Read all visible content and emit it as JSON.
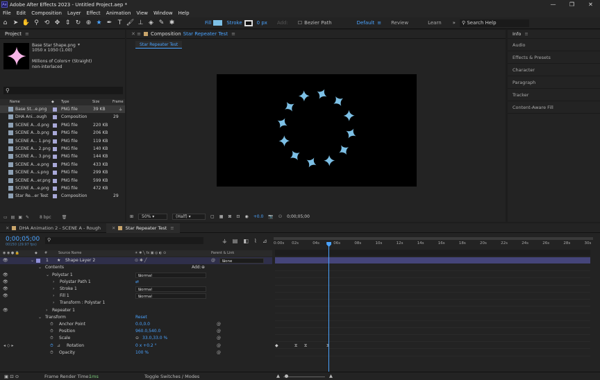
{
  "app": {
    "logo": "Ae",
    "title": "Adobe After Effects 2023 - Untitled Project.aep *"
  },
  "window_controls": [
    "—",
    "❐",
    "✕"
  ],
  "menu": [
    "File",
    "Edit",
    "Composition",
    "Layer",
    "Effect",
    "Animation",
    "View",
    "Window",
    "Help"
  ],
  "toolbar": {
    "fill_label": "Fill",
    "stroke_label": "Stroke",
    "stroke_px": "0 px",
    "add_label": "Add:",
    "bezier_label": "Bezier Path",
    "workspaces": [
      "Default",
      "Review",
      "Learn"
    ],
    "search_placeholder": "Search Help",
    "fill_color": "#7dc0e6"
  },
  "project": {
    "title": "Project",
    "asset_name": "Base Star Shape.png",
    "asset_dims": "1050 x 1050 (1.00)",
    "asset_colors": "Millions of Colors+ (Straight)",
    "asset_interlace": "non-interlaced",
    "search_placeholder": "",
    "columns": {
      "name": "Name",
      "type": "Type",
      "size": "Size",
      "frame": "Frame"
    },
    "items": [
      {
        "name": "Base St...e.png",
        "type": "PNG file",
        "size": "39 KB",
        "frame": "",
        "color": "#a8a8d8"
      },
      {
        "name": "DHA Ani...ough",
        "type": "Composition",
        "size": "",
        "frame": "29",
        "color": "#a8a8d8"
      },
      {
        "name": "SCENE A...d.png",
        "type": "PNG file",
        "size": "220 KB",
        "frame": "",
        "color": "#a8a8d8"
      },
      {
        "name": "SCENE A...b.png",
        "type": "PNG file",
        "size": "206 KB",
        "frame": "",
        "color": "#a8a8d8"
      },
      {
        "name": "SCENE A... 1.png",
        "type": "PNG file",
        "size": "119 KB",
        "frame": "",
        "color": "#a8a8d8"
      },
      {
        "name": "SCENE A... 2.png",
        "type": "PNG file",
        "size": "140 KB",
        "frame": "",
        "color": "#a8a8d8"
      },
      {
        "name": "SCENE A... 3.png",
        "type": "PNG file",
        "size": "144 KB",
        "frame": "",
        "color": "#a8a8d8"
      },
      {
        "name": "SCENE A...e.png",
        "type": "PNG file",
        "size": "433 KB",
        "frame": "",
        "color": "#a8a8d8"
      },
      {
        "name": "SCENE A...s.png",
        "type": "PNG file",
        "size": "299 KB",
        "frame": "",
        "color": "#a8a8d8"
      },
      {
        "name": "SCENE A...er.png",
        "type": "PNG file",
        "size": "599 KB",
        "frame": "",
        "color": "#a8a8d8"
      },
      {
        "name": "SCENE A...e.png",
        "type": "PNG file",
        "size": "472 KB",
        "frame": "",
        "color": "#a8a8d8"
      },
      {
        "name": "Star Re...er Test",
        "type": "Composition",
        "size": "",
        "frame": "29",
        "color": "#a8a8d8"
      }
    ],
    "bpc": "8 bpc"
  },
  "composition": {
    "panel_label": "Composition",
    "comp_name": "Star Repeater Test",
    "sub_tab": "Star Repeater Test",
    "zoom": "50%",
    "resolution": "(Half)",
    "exposure": "+0.0",
    "timecode": "0;00;05;00",
    "star_color": "#7dc0e6",
    "star_count": 12
  },
  "right_panel": [
    "Info",
    "Audio",
    "Effects & Presets",
    "Character",
    "Paragraph",
    "Tracker",
    "Content-Aware Fill"
  ],
  "timeline": {
    "tabs": [
      "DHA Animation 2 - SCENE A - Rough",
      "Star Repeater Test"
    ],
    "timecode": "0;00;05;00",
    "fps": "00150 (29.97 fps)",
    "columns": {
      "num": "#",
      "source": "Source Name",
      "parent": "Parent & Link"
    },
    "layer": {
      "num": "1",
      "name": "Shape Layer 2",
      "parent": "None"
    },
    "rows": {
      "contents": "Contents",
      "add": "Add:",
      "polystar1": "Polystar 1",
      "mode_normal": "Normal",
      "polystar_path": "Polystar Path 1",
      "stroke1": "Stroke 1",
      "fill1": "Fill 1",
      "transform_polystar": "Transform : Polystar 1",
      "repeater1": "Repeater 1",
      "transform": "Transform",
      "reset": "Reset",
      "anchor": "Anchor Point",
      "anchor_val": "0.0,0.0",
      "position": "Position",
      "position_val": "960.0,540.0",
      "scale": "Scale",
      "scale_val": "33.0,33.0 %",
      "rotation": "Rotation",
      "rotation_val": "0 x +0.2 °",
      "opacity": "Opacity",
      "opacity_val": "100 %"
    },
    "ruler_labels": [
      "0:00s",
      "02s",
      "04s",
      "06s",
      "08s",
      "10s",
      "12s",
      "14s",
      "16s",
      "18s",
      "20s",
      "22s",
      "24s",
      "26s",
      "28s",
      "30s"
    ],
    "playhead_seconds": 5,
    "duration_seconds": 30
  },
  "status": {
    "render_label": "Frame Render Time:",
    "render_value": "1ms",
    "toggle": "Toggle Switches / Modes"
  }
}
